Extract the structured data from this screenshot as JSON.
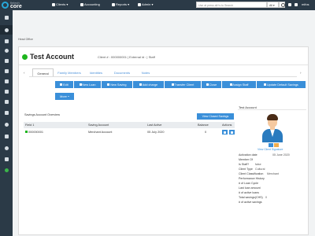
{
  "topbar": {
    "brand_top": "fintech",
    "brand_bottom": "core",
    "nav": [
      "Clients",
      "Accounting",
      "Reports",
      "Admin"
    ],
    "search_placeholder": "Use at press alt+s to Search",
    "search_scope": "All",
    "user": "mifos"
  },
  "breadcrumb": "Head Office",
  "account": {
    "title": "Test Account",
    "meta": "Client # : 000000001 | External id : | Staff",
    "status_color": "#1db51d"
  },
  "tabs": [
    "General",
    "Family Members",
    "Identities",
    "Documents",
    "Notes"
  ],
  "actions": [
    {
      "label": "Edit"
    },
    {
      "label": "New Loan"
    },
    {
      "label": "New Saving"
    },
    {
      "label": "Add charge"
    },
    {
      "label": "Transfer Client"
    },
    {
      "label": "Close"
    },
    {
      "label": "Assign Staff"
    },
    {
      "label": "Update Default Savings"
    },
    {
      "label": "More"
    }
  ],
  "savings": {
    "title": "Savings Account Overview",
    "view_closed": "View Closed Savings",
    "columns": [
      "Field 1",
      "Saving Account",
      "Last Active",
      "Balance",
      "Actions"
    ],
    "rows": [
      {
        "account": "000000001",
        "product": "Merchant Account",
        "last_active": "05 July 2020",
        "balance": "0"
      }
    ]
  },
  "profile": {
    "title": "Test Account",
    "signature_link": "View Client Signature",
    "details": [
      {
        "label": "Activation date",
        "value": "05 June 2020"
      },
      {
        "label": "Member Of",
        "value": ""
      },
      {
        "label": "Is Staff?",
        "value": "false"
      },
      {
        "label": "Client Type",
        "value": "Cultural"
      },
      {
        "label": "Client Classification",
        "value": "Merchant"
      },
      {
        "label": "Performance History",
        "value": ""
      },
      {
        "label": "# of Loan Cycle",
        "value": ""
      },
      {
        "label": "Last loan amount",
        "value": ""
      },
      {
        "label": "# of active loans",
        "value": ""
      },
      {
        "label": "Total savings(CHS)",
        "value": "0"
      },
      {
        "label": "# of active savings",
        "value": ""
      }
    ]
  },
  "colors": {
    "accent": "#3a8fd9",
    "sidebar": "#2b3a47",
    "active_status": "#1db51d"
  }
}
